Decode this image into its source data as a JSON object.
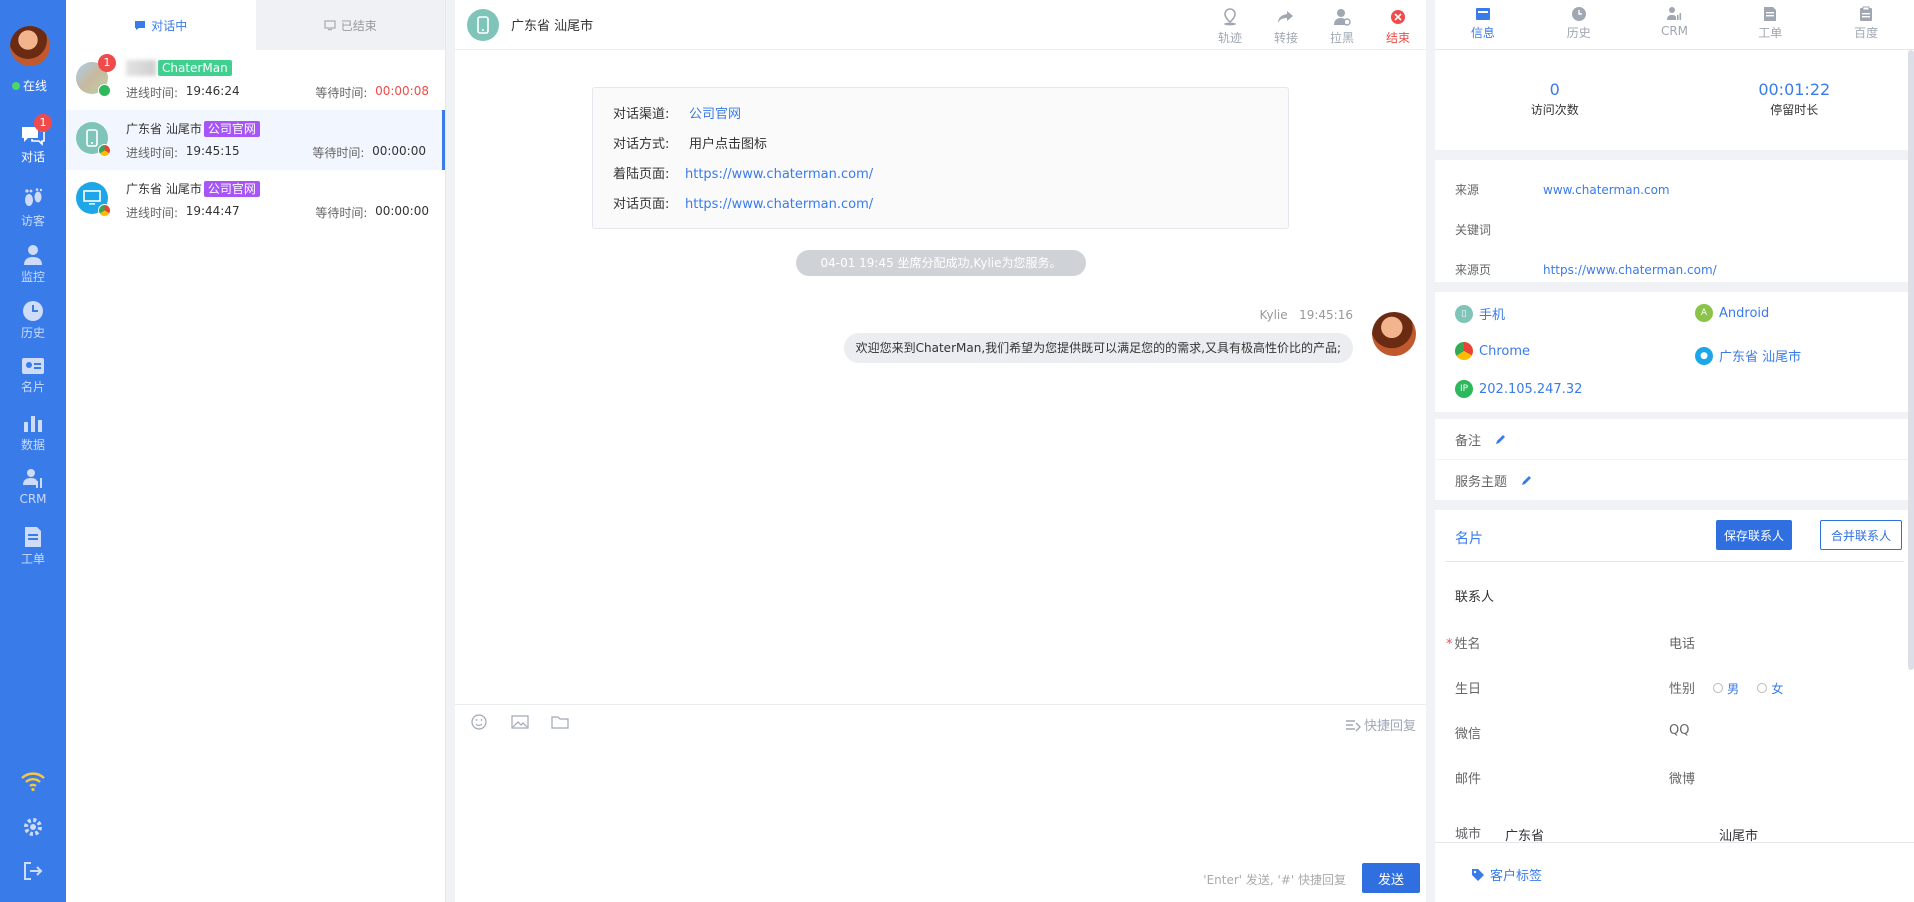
{
  "nav": {
    "status": "在线",
    "items": [
      {
        "label": "对话",
        "badge": "1"
      },
      {
        "label": "访客"
      },
      {
        "label": "监控"
      },
      {
        "label": "历史"
      },
      {
        "label": "名片"
      },
      {
        "label": "数据"
      },
      {
        "label": "CRM"
      },
      {
        "label": "工单"
      }
    ]
  },
  "list": {
    "tabs": [
      "对话中",
      "已结束"
    ],
    "conversations": [
      {
        "title": "",
        "tag": "ChaterMan",
        "badge": "1",
        "enter_label": "进线时间:",
        "enter_time": "19:46:24",
        "wait_label": "等待时间:",
        "wait_time": "00:00:08"
      },
      {
        "title": "广东省 汕尾市",
        "tag": "公司官网",
        "enter_label": "进线时间:",
        "enter_time": "19:45:15",
        "wait_label": "等待时间:",
        "wait_time": "00:00:00"
      },
      {
        "title": "广东省 汕尾市",
        "tag": "公司官网",
        "enter_label": "进线时间:",
        "enter_time": "19:44:47",
        "wait_label": "等待时间:",
        "wait_time": "00:00:00"
      }
    ]
  },
  "chat": {
    "location": "广东省 汕尾市",
    "actions": [
      "轨迹",
      "转接",
      "拉黑",
      "结束"
    ],
    "info": [
      {
        "key": "对话渠道:",
        "value": "公司官网"
      },
      {
        "key": "对话方式:",
        "value": "用户点击图标"
      },
      {
        "key": "着陆页面:",
        "value": "https://www.chaterman.com/"
      },
      {
        "key": "对话页面:",
        "value": "https://www.chaterman.com/"
      }
    ],
    "system_message": "04-01 19:45 坐席分配成功,Kylie为您服务。",
    "message": {
      "sender": "Kylie",
      "time": "19:45:16",
      "text": "欢迎您来到ChaterMan,我们希望为您提供既可以满足您的的需求,又具有极高性价比的产品;"
    },
    "quick_reply": "快捷回复",
    "send_hint": "'Enter' 发送, '#' 快捷回复",
    "send_label": "发送"
  },
  "panel": {
    "tabs": [
      "信息",
      "历史",
      "CRM",
      "工单",
      "百度"
    ],
    "visits": {
      "value": "0",
      "label": "访问次数"
    },
    "stay": {
      "value": "00:01:22",
      "label": "停留时长"
    },
    "source": [
      {
        "key": "来源",
        "value": "www.chaterman.com"
      },
      {
        "key": "关键词",
        "value": ""
      },
      {
        "key": "来源页",
        "value": "https://www.chaterman.com/"
      }
    ],
    "env": {
      "device": "手机",
      "os": "Android",
      "browser": "Chrome",
      "location": "广东省 汕尾市",
      "ip": "202.105.247.32"
    },
    "remark": "备注",
    "topic": "服务主题",
    "card": {
      "title": "名片",
      "save": "保存联系人",
      "merge": "合并联系人",
      "contact": "联系人",
      "name": "姓名",
      "phone": "电话",
      "birthday": "生日",
      "gender": "性别",
      "male": "男",
      "female": "女",
      "wechat": "微信",
      "qq": "QQ",
      "email": "邮件",
      "weibo": "微博",
      "city": "城市",
      "province": "广东省",
      "city_value": "汕尾市"
    },
    "tags": "客户标签"
  }
}
